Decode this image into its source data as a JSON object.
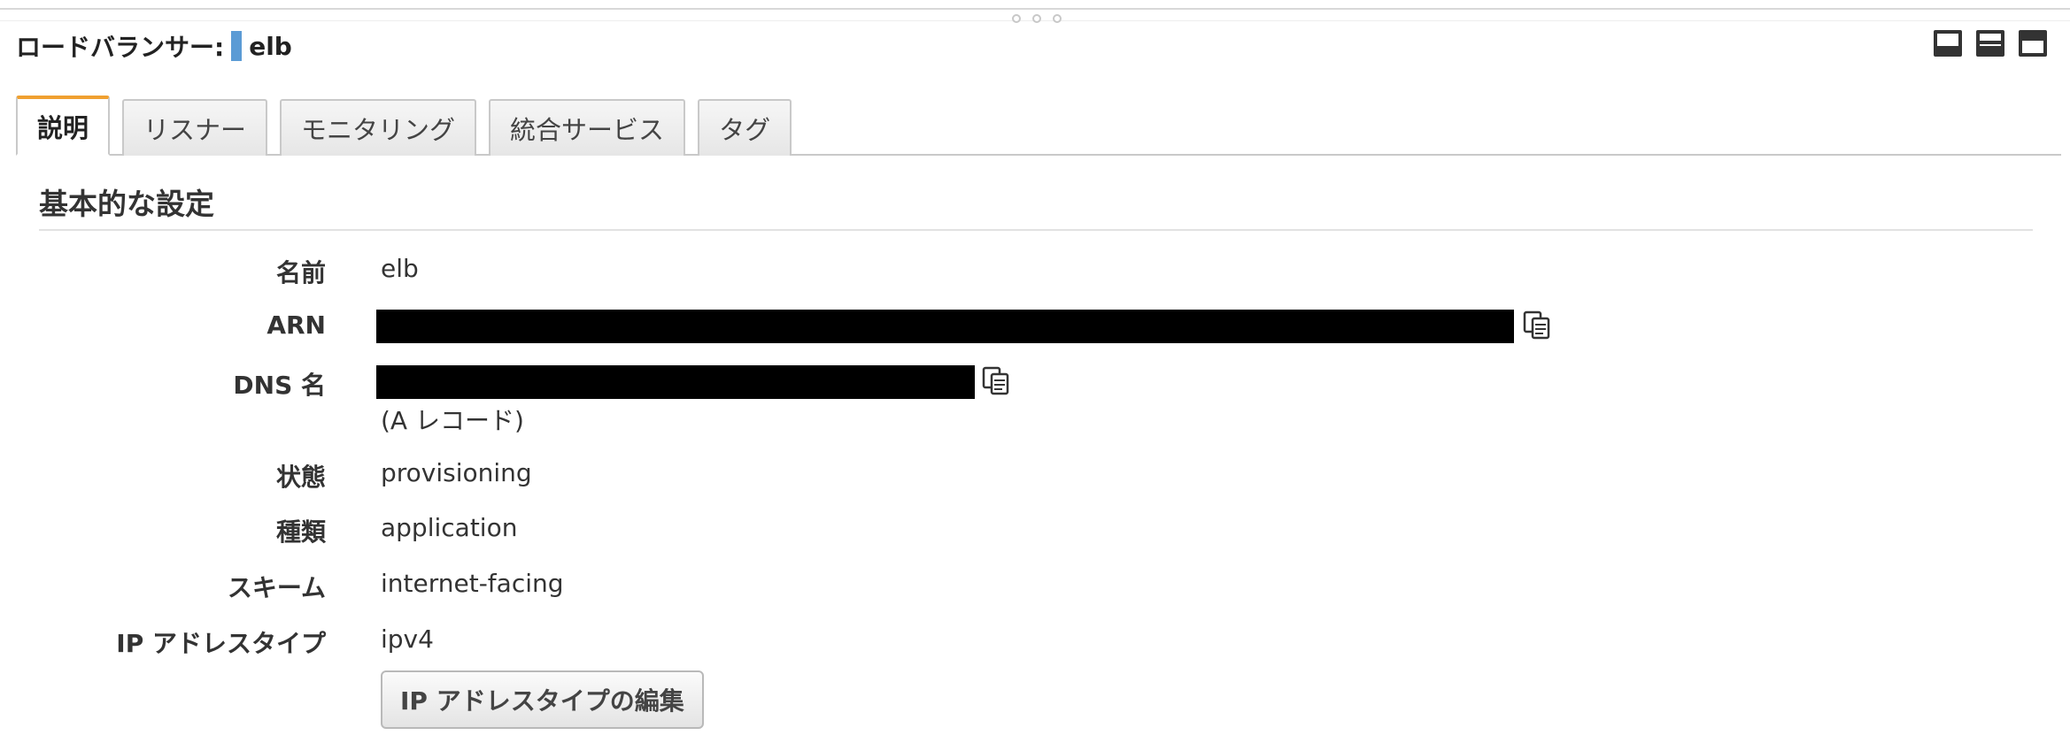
{
  "header": {
    "label": "ロードバランサー:",
    "name": "elb",
    "marker_color": "#5b9bd5"
  },
  "layout_icons": [
    "panel-bottom-icon",
    "panel-split-icon",
    "panel-top-icon"
  ],
  "tabs": [
    {
      "label": "説明",
      "active": true
    },
    {
      "label": "リスナー",
      "active": false
    },
    {
      "label": "モニタリング",
      "active": false
    },
    {
      "label": "統合サービス",
      "active": false
    },
    {
      "label": "タグ",
      "active": false
    }
  ],
  "section": {
    "title": "基本的な設定"
  },
  "details": {
    "name": {
      "label": "名前",
      "value": "elb"
    },
    "arn": {
      "label": "ARN"
    },
    "dns": {
      "label": "DNS 名",
      "note": "(A レコード)"
    },
    "state": {
      "label": "状態",
      "value": "provisioning"
    },
    "type": {
      "label": "種類",
      "value": "application"
    },
    "scheme": {
      "label": "スキーム",
      "value": "internet-facing"
    },
    "ip_type": {
      "label": "IP アドレスタイプ",
      "value": "ipv4"
    }
  },
  "buttons": {
    "edit_ip_type": "IP アドレスタイプの編集"
  },
  "colors": {
    "active_tab_accent": "#f0a030",
    "redaction": "#000000"
  }
}
